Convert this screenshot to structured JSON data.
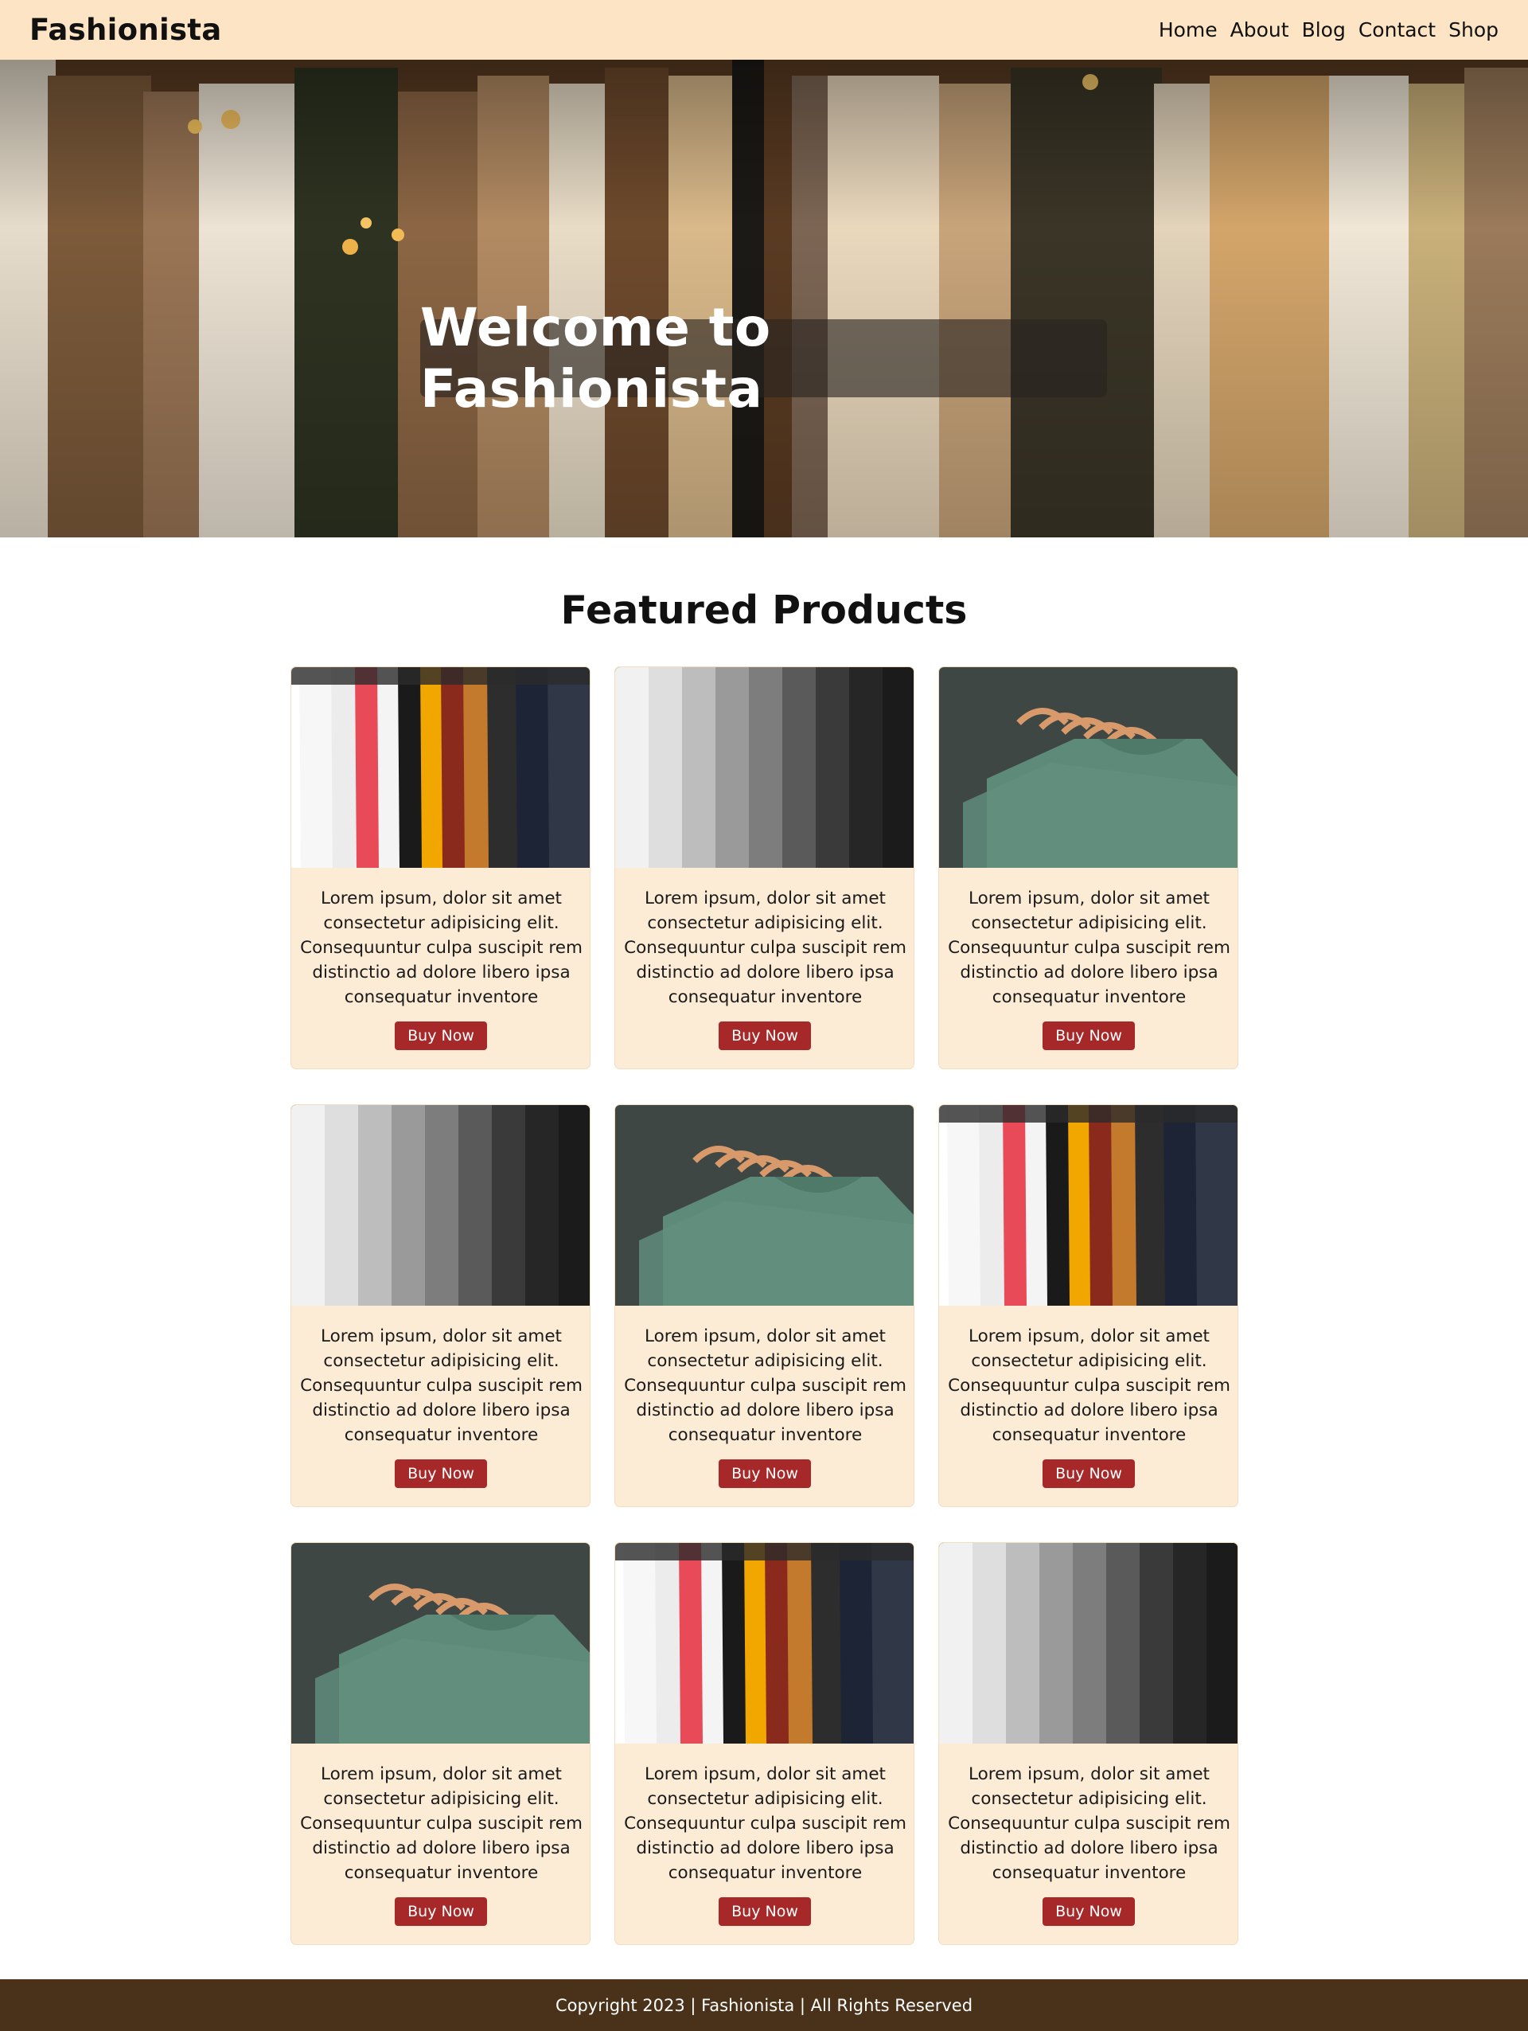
{
  "nav": {
    "brand": "Fashionista",
    "items": [
      "Home",
      "About",
      "Blog",
      "Contact",
      "Shop"
    ]
  },
  "hero": {
    "title": "Welcome to Fashionista"
  },
  "featured": {
    "title": "Featured Products",
    "products": [
      {
        "image": "colorful-shirts-photo",
        "description": "Lorem ipsum, dolor sit amet consectetur adipisicing elit. Consequuntur culpa suscipit rem distinctio ad dolore libero ipsa consequatur inventore",
        "button": "Buy Now"
      },
      {
        "image": "grey-tshirts-photo",
        "description": "Lorem ipsum, dolor sit amet consectetur adipisicing elit. Consequuntur culpa suscipit rem distinctio ad dolore libero ipsa consequatur inventore",
        "button": "Buy Now"
      },
      {
        "image": "green-tshirts-photo",
        "description": "Lorem ipsum, dolor sit amet consectetur adipisicing elit. Consequuntur culpa suscipit rem distinctio ad dolore libero ipsa consequatur inventore",
        "button": "Buy Now"
      },
      {
        "image": "grey-tshirts-photo",
        "description": "Lorem ipsum, dolor sit amet consectetur adipisicing elit. Consequuntur culpa suscipit rem distinctio ad dolore libero ipsa consequatur inventore",
        "button": "Buy Now"
      },
      {
        "image": "green-tshirts-photo",
        "description": "Lorem ipsum, dolor sit amet consectetur adipisicing elit. Consequuntur culpa suscipit rem distinctio ad dolore libero ipsa consequatur inventore",
        "button": "Buy Now"
      },
      {
        "image": "colorful-shirts-photo",
        "description": "Lorem ipsum, dolor sit amet consectetur adipisicing elit. Consequuntur culpa suscipit rem distinctio ad dolore libero ipsa consequatur inventore",
        "button": "Buy Now"
      },
      {
        "image": "green-tshirts-photo",
        "description": "Lorem ipsum, dolor sit amet consectetur adipisicing elit. Consequuntur culpa suscipit rem distinctio ad dolore libero ipsa consequatur inventore",
        "button": "Buy Now"
      },
      {
        "image": "colorful-shirts-photo",
        "description": "Lorem ipsum, dolor sit amet consectetur adipisicing elit. Consequuntur culpa suscipit rem distinctio ad dolore libero ipsa consequatur inventore",
        "button": "Buy Now"
      },
      {
        "image": "grey-tshirts-photo",
        "description": "Lorem ipsum, dolor sit amet consectetur adipisicing elit. Consequuntur culpa suscipit rem distinctio ad dolore libero ipsa consequatur inventore",
        "button": "Buy Now"
      }
    ]
  },
  "footer": {
    "text": "Copyright 2023 | Fashionista | All Rights Reserved"
  },
  "colors": {
    "nav_bg": "#fde4c4",
    "card_bg": "#fcecd6",
    "button_bg": "#a72828",
    "footer_bg": "#4a311a"
  }
}
